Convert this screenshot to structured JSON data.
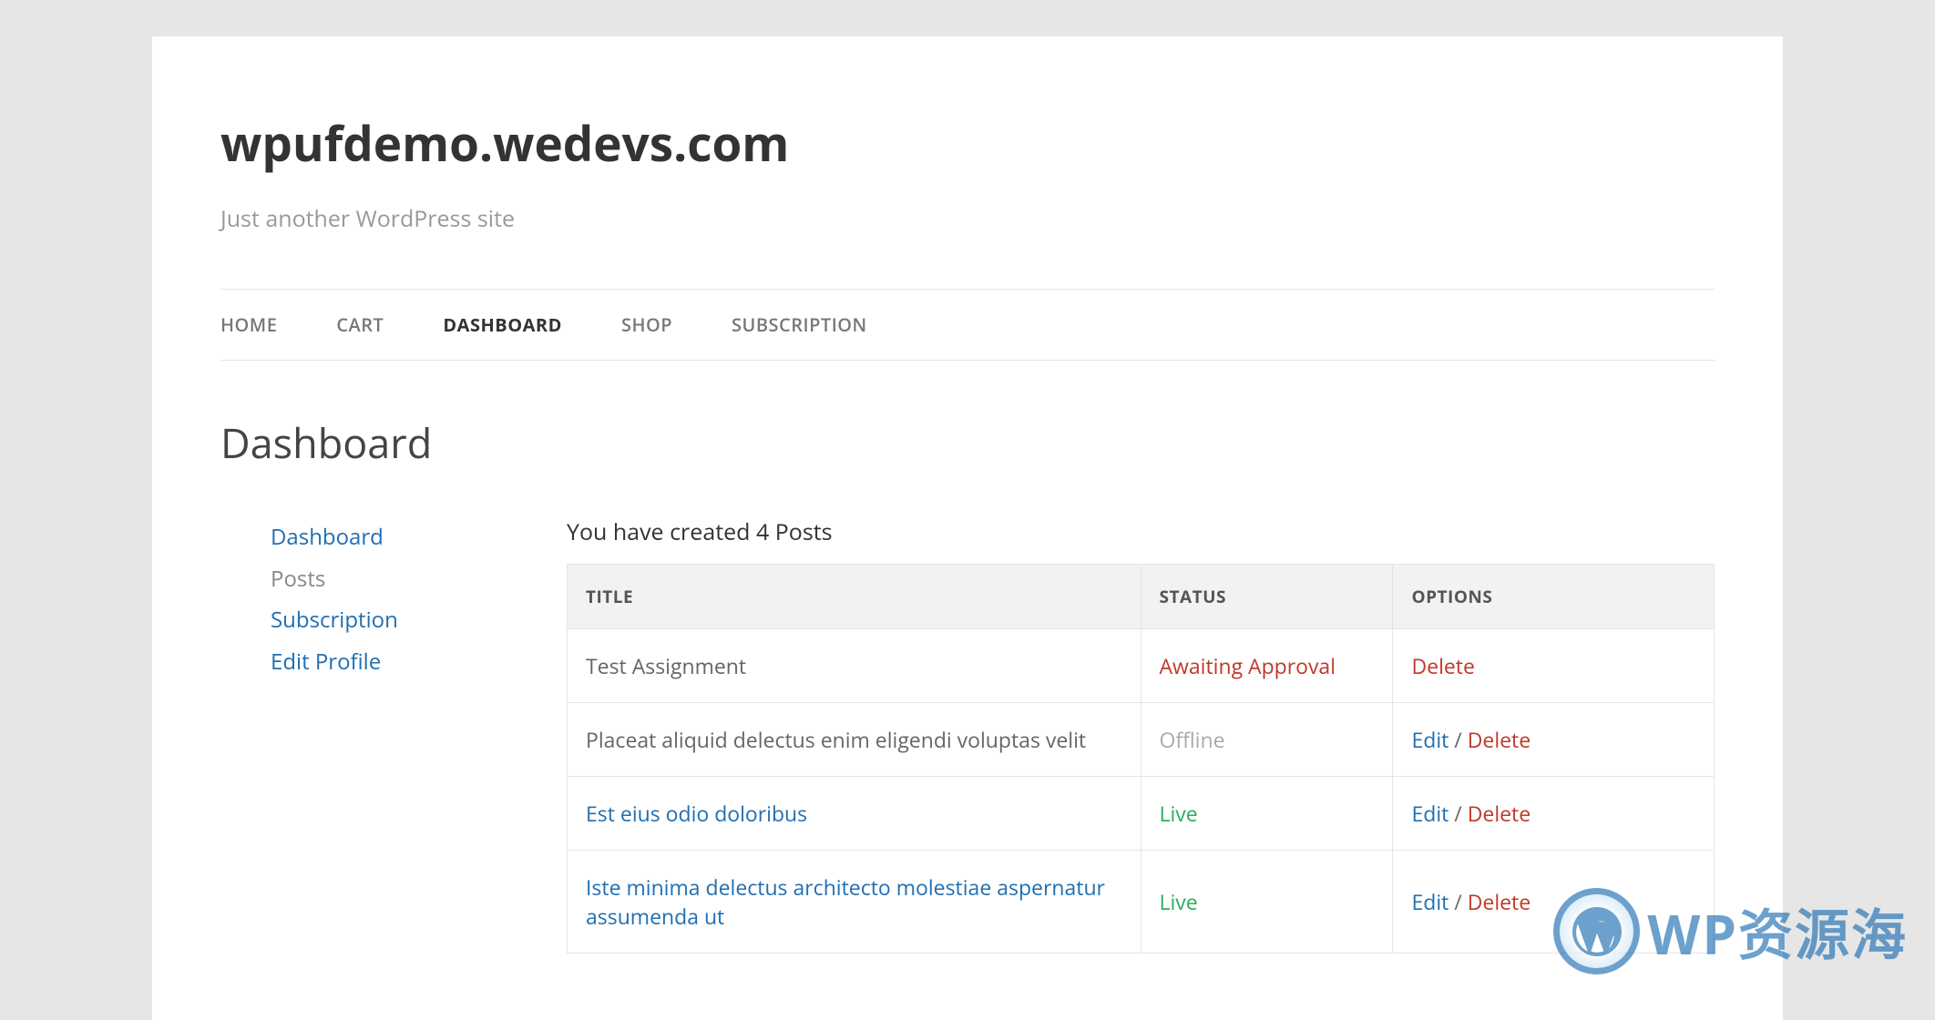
{
  "site": {
    "title": "wpufdemo.wedevs.com",
    "tagline": "Just another WordPress site"
  },
  "nav": {
    "items": [
      {
        "label": "HOME",
        "active": false
      },
      {
        "label": "CART",
        "active": false
      },
      {
        "label": "DASHBOARD",
        "active": true
      },
      {
        "label": "SHOP",
        "active": false
      },
      {
        "label": "SUBSCRIPTION",
        "active": false
      }
    ]
  },
  "page": {
    "title": "Dashboard"
  },
  "sidebar": {
    "items": [
      {
        "label": "Dashboard",
        "current": false
      },
      {
        "label": "Posts",
        "current": true
      },
      {
        "label": "Subscription",
        "current": false
      },
      {
        "label": "Edit Profile",
        "current": false
      }
    ]
  },
  "summary": "You have created 4 Posts",
  "table": {
    "headers": {
      "title": "TITLE",
      "status": "STATUS",
      "options": "OPTIONS"
    },
    "rows": [
      {
        "title": "Test Assignment",
        "title_is_link": false,
        "status": "Awaiting Approval",
        "status_class": "status-awaiting",
        "edit": "",
        "delete": "Delete"
      },
      {
        "title": "Placeat aliquid delectus enim eligendi voluptas velit",
        "title_is_link": false,
        "status": "Offline",
        "status_class": "status-offline",
        "edit": "Edit",
        "delete": "Delete"
      },
      {
        "title": "Est eius odio doloribus",
        "title_is_link": true,
        "status": "Live",
        "status_class": "status-live",
        "edit": "Edit",
        "delete": "Delete"
      },
      {
        "title": "Iste minima delectus architecto molestiae aspernatur assumenda ut",
        "title_is_link": true,
        "status": "Live",
        "status_class": "status-live",
        "edit": "Edit",
        "delete": "Delete"
      }
    ]
  },
  "watermark": "WP资源海"
}
